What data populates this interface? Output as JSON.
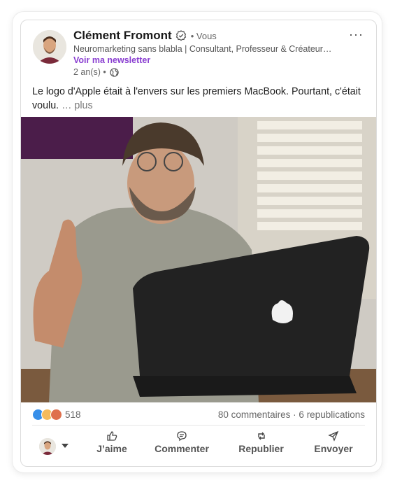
{
  "post": {
    "author_name": "Clément Fromont",
    "you_label": "• Vous",
    "headline": "Neuromarketing sans blabla | Consultant, Professeur & Créateur…",
    "newsletter_link": "Voir ma newsletter",
    "time": "2 an(s) •",
    "text": "Le logo d'Apple était à l'envers sur les premiers MacBook. Pourtant, c'était voulu.",
    "see_more": "… plus"
  },
  "stats": {
    "reaction_count": "518",
    "comments_reposts": "80 commentaires · 6 republications"
  },
  "actions": {
    "like": "J’aime",
    "comment": "Commenter",
    "repost": "Republier",
    "send": "Envoyer"
  },
  "colors": {
    "newsletter": "#8a3fd1",
    "like_reaction": "#378fe9",
    "celebrate_reaction": "#f5bb5c",
    "love_reaction": "#df704d"
  },
  "icons": [
    "verified-icon",
    "globe-icon",
    "more-options-icon",
    "like-icon",
    "comment-icon",
    "repost-icon",
    "send-icon",
    "caret-down-icon"
  ]
}
